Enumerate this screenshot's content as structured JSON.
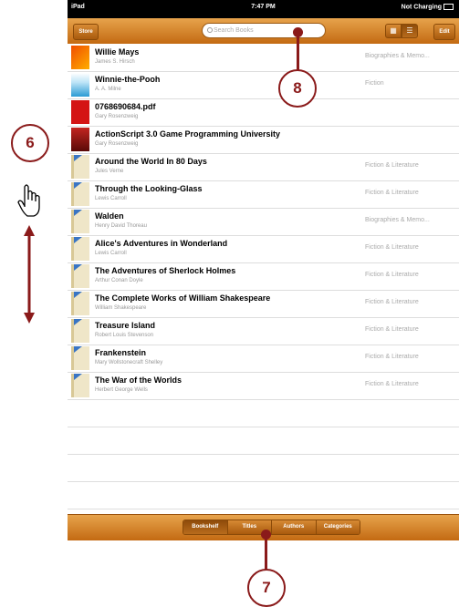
{
  "status_bar": {
    "device": "iPad",
    "time": "7:47 PM",
    "battery": "Not Charging"
  },
  "toolbar": {
    "store_label": "Store",
    "search_placeholder": "Search Books",
    "edit_label": "Edit",
    "grid_icon": "grid-view-icon",
    "list_icon": "list-view-icon"
  },
  "books": [
    {
      "title": "Willie Mays",
      "author": "James S. Hirsch",
      "category": "Biographies & Memo...",
      "cover": "orange"
    },
    {
      "title": "Winnie-the-Pooh",
      "author": "A. A. Milne",
      "category": "Fiction",
      "cover": "blue"
    },
    {
      "title": "0768690684.pdf",
      "author": "Gary Rosenzweig",
      "category": "",
      "cover": "red"
    },
    {
      "title": "ActionScript 3.0 Game Programming University",
      "author": "Gary Rosenzweig",
      "category": "",
      "cover": "dark"
    },
    {
      "title": "Around the World In 80 Days",
      "author": "Jules Verne",
      "category": "Fiction & Literature",
      "cover": "plain"
    },
    {
      "title": "Through the Looking-Glass",
      "author": "Lewis Carroll",
      "category": "Fiction & Literature",
      "cover": "plain"
    },
    {
      "title": "Walden",
      "author": "Henry David Thoreau",
      "category": "Biographies & Memo...",
      "cover": "plain"
    },
    {
      "title": "Alice's Adventures in Wonderland",
      "author": "Lewis Carroll",
      "category": "Fiction & Literature",
      "cover": "plain"
    },
    {
      "title": "The Adventures of Sherlock Holmes",
      "author": "Arthur Conan Doyle",
      "category": "Fiction & Literature",
      "cover": "plain"
    },
    {
      "title": "The Complete Works of William Shakespeare",
      "author": "William Shakespeare",
      "category": "Fiction & Literature",
      "cover": "plain"
    },
    {
      "title": "Treasure Island",
      "author": "Robert Louis Stevenson",
      "category": "Fiction & Literature",
      "cover": "plain"
    },
    {
      "title": "Frankenstein",
      "author": "Mary Wollstonecraft Shelley",
      "category": "Fiction & Literature",
      "cover": "plain"
    },
    {
      "title": "The War of the Worlds",
      "author": "Herbert George Wells",
      "category": "Fiction & Literature",
      "cover": "plain"
    }
  ],
  "bottom_tabs": [
    "Bookshelf",
    "Titles",
    "Authors",
    "Categories"
  ],
  "active_tab": "Bookshelf",
  "callouts": {
    "six": "6",
    "seven": "7",
    "eight": "8"
  },
  "icons": {
    "gesture": "swipe-hand-icon",
    "arrow": "up-down-arrow-icon"
  },
  "colors": {
    "accent": "#c87419",
    "callout": "#8a1a1a"
  }
}
